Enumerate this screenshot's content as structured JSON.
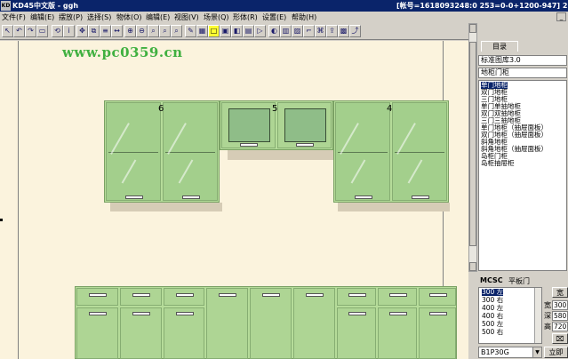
{
  "window": {
    "app_icon": "KD",
    "title": "KD45中文版 - ggh",
    "account": "[帐号=1618093248:0 253=0-0+1200-947] 21:05"
  },
  "menu": [
    "文件(F)",
    "编辑(E)",
    "摆放(P)",
    "选择(S)",
    "物体(O)",
    "编辑(E)",
    "视图(V)",
    "场景(Q)",
    "形体(R)",
    "设置(E)",
    "帮助(H)"
  ],
  "toolbar_icons": [
    "pointer-icon",
    "undo-icon",
    "redo-icon",
    "select-icon",
    "rotate-icon",
    "info-icon",
    "move-icon",
    "copy-icon",
    "align-icon",
    "stretch-icon",
    "zoom-in-icon",
    "zoom-out-icon",
    "zoom-window-icon",
    "zoom-all-icon",
    "zoom-prev-icon",
    "render-icon",
    "view-front-icon",
    "rect-icon",
    "box-icon",
    "cube-icon",
    "panel-icon",
    "play-icon",
    "paint-icon",
    "material-icon",
    "texture-icon",
    "light-icon",
    "camera-icon",
    "export-icon",
    "print-icon",
    "exit-icon"
  ],
  "watermark": "www.pc0359.cn",
  "cabinets": {
    "upper_left_number": "6",
    "upper_mid_number": "5",
    "upper_right_number": "4"
  },
  "panel": {
    "tab_label": "目录",
    "library": "标准图库3.0",
    "category": "地柜门柜",
    "items": [
      "单门地柜",
      "双门地柜",
      "三门地柜",
      "单门单抽地柜",
      "双门双抽地柜",
      "三门三抽地柜",
      "单门地柜（抽屉面板）",
      "双门地柜（抽屉面板）",
      "斜角地柜",
      "斜角地柜（抽屉面板）",
      "岛柜门柜",
      "岛柜抽屉柜"
    ],
    "selected_index": 0,
    "sub_title": "MCSC",
    "door_type": "平板门",
    "sizes": [
      "300 左",
      "300 右",
      "400 左",
      "400 右",
      "500 左",
      "500 右"
    ],
    "selected_size_index": 0,
    "dims": {
      "width_label": "宽",
      "width": "300",
      "depth_label": "深",
      "depth": "580",
      "height_label": "高",
      "height": "720"
    },
    "view_button": "宽",
    "material_code": "B1P30G",
    "place_button": "立即"
  }
}
